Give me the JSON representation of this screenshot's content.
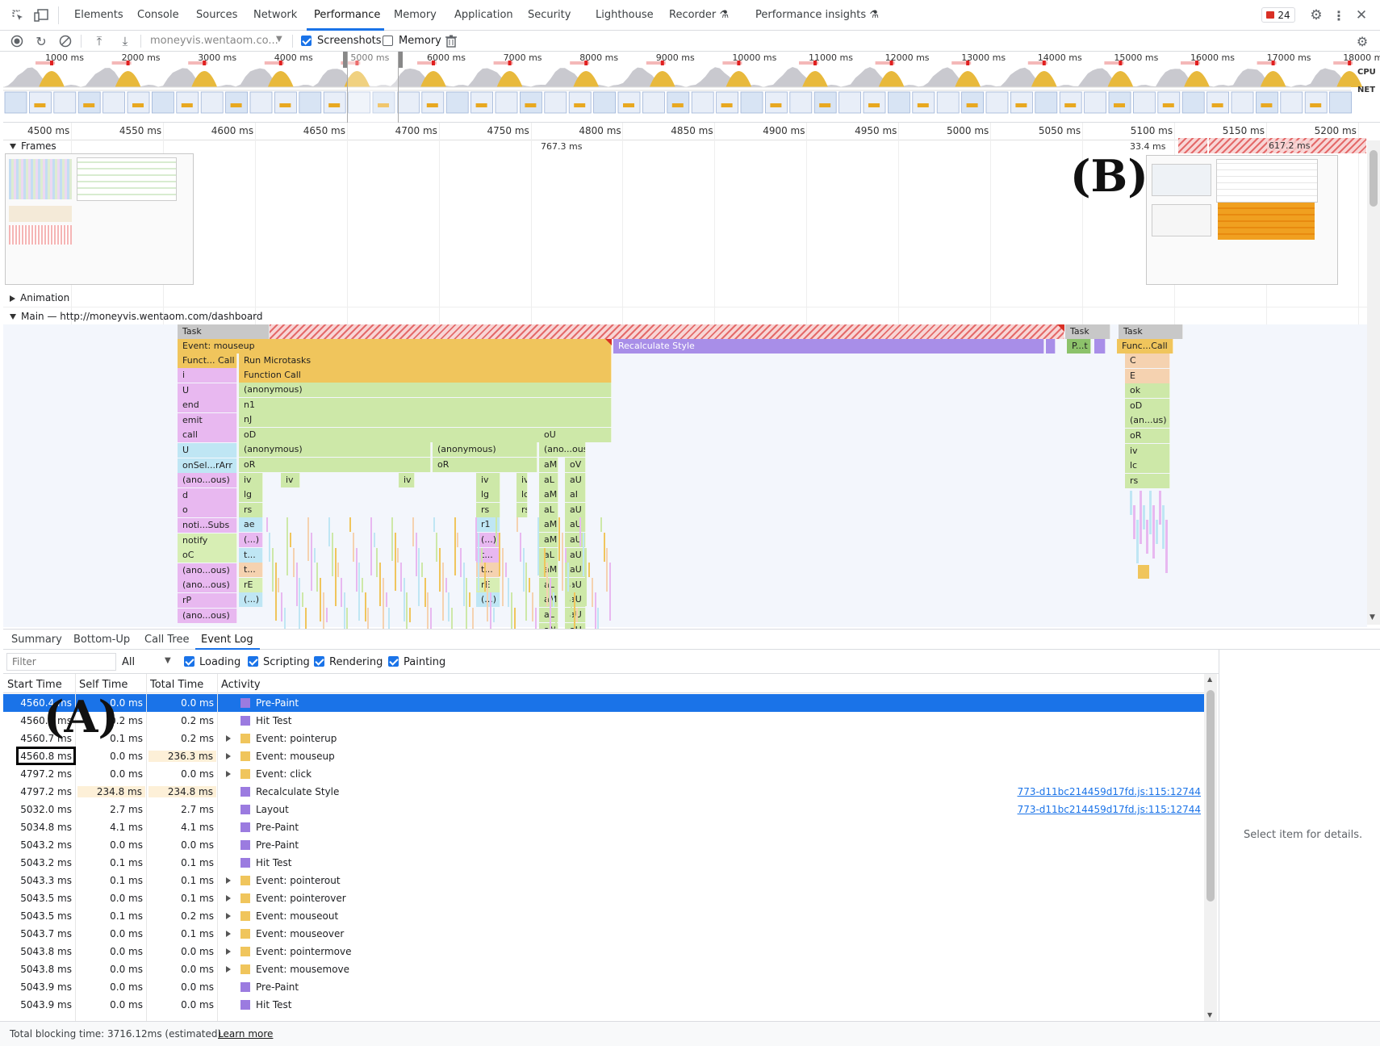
{
  "tabs": [
    "Elements",
    "Console",
    "Sources",
    "Network",
    "Performance",
    "Memory",
    "Application",
    "Security",
    "Lighthouse",
    "Recorder",
    "Performance insights"
  ],
  "active_tab": "Performance",
  "issues_count": "24",
  "toolbar": {
    "url": "moneyvis.wentaom.co...",
    "screenshots_label": "Screenshots",
    "memory_label": "Memory"
  },
  "overview": {
    "labels": [
      "1000 ms",
      "2000 ms",
      "3000 ms",
      "4000 ms",
      "5000 ms",
      "6000 ms",
      "7000 ms",
      "8000 ms",
      "9000 ms",
      "10000 ms",
      "11000 ms",
      "12000 ms",
      "13000 ms",
      "14000 ms",
      "15000 ms",
      "16000 ms",
      "17000 ms",
      "18000 ms"
    ],
    "cpu_label": "CPU",
    "net_label": "NET"
  },
  "ruler": {
    "labels": [
      "4500 ms",
      "4550 ms",
      "4600 ms",
      "4650 ms",
      "4700 ms",
      "4750 ms",
      "4800 ms",
      "4850 ms",
      "4900 ms",
      "4950 ms",
      "5000 ms",
      "5050 ms",
      "5100 ms",
      "5150 ms",
      "5200 ms"
    ]
  },
  "tracks": {
    "frames_label": "Frames",
    "frame_duration_1": "767.3 ms",
    "frame_duration_2": "33.4 ms",
    "frame_duration_3": "617.2 ms",
    "animation_label": "Animation",
    "main_label": "Main — http://moneyvis.wentaom.com/dashboard"
  },
  "flame": {
    "task": "Task",
    "task2": "Task",
    "task3": "Task",
    "event_mouseup": "Event: mouseup",
    "recalc": "Recalculate Style",
    "pt": "P...t",
    "funccall_r": "Func...Call",
    "funct_call": "Funct... Call",
    "run_micro": "Run Microtasks",
    "function_call": "Function Call",
    "left_col": [
      "i",
      "U",
      "end",
      "emit",
      "call",
      "U",
      "onSel...rArr",
      "(ano...ous)",
      "d",
      "o",
      "noti...Subs",
      "notify",
      "oC",
      "(ano...ous)",
      "(ano...ous)",
      "rP",
      "(ano...ous)"
    ],
    "col2": [
      "(anonymous)",
      "n1",
      "nJ",
      "oD",
      "(anonymous)",
      "oR",
      "iv",
      "lg",
      "rs",
      "ae",
      "(...)",
      "t...",
      "t...",
      "rE",
      "(...)"
    ],
    "col2_small": [
      "iv"
    ],
    "col3": [
      "(anonymous)",
      "oR"
    ],
    "col3b": [
      "iv",
      "lg",
      "rs",
      "r1",
      "(...)",
      "t...",
      "t...",
      "rE",
      "(...)"
    ],
    "col_iv": [
      "iv",
      "lc",
      "rs"
    ],
    "col_ou": [
      "oU",
      "(ano...ous)",
      "aM",
      "aL",
      "aM",
      "aL",
      "aM",
      "aM",
      "aL",
      "aM",
      "aL",
      "aM",
      "aL",
      "aM"
    ],
    "col_ov": [
      "oV",
      "aU",
      "aI",
      "aU",
      "aU",
      "aU",
      "aU",
      "aU",
      "aU",
      "aU",
      "aU",
      "aU"
    ],
    "right_col": [
      "C",
      "E",
      "ok",
      "oD",
      "(an...us)",
      "oR",
      "iv",
      "lc",
      "rs"
    ]
  },
  "bottom_tabs": [
    "Summary",
    "Bottom-Up",
    "Call Tree",
    "Event Log"
  ],
  "active_bottom_tab": "Event Log",
  "filter": {
    "placeholder": "Filter",
    "select_value": "All",
    "checkboxes": [
      "Loading",
      "Scripting",
      "Rendering",
      "Painting"
    ]
  },
  "table": {
    "headers": [
      "Start Time",
      "Self Time",
      "Total Time",
      "Activity"
    ],
    "rows": [
      {
        "start": "4560.4 ms",
        "self": "0.0 ms",
        "total": "0.0 ms",
        "activity": "Pre-Paint",
        "color": "#9b7be0",
        "expand": false,
        "link": ""
      },
      {
        "start": "4560.4 ms",
        "self": "0.2 ms",
        "total": "0.2 ms",
        "activity": "Hit Test",
        "color": "#9b7be0",
        "expand": false,
        "link": ""
      },
      {
        "start": "4560.7 ms",
        "self": "0.1 ms",
        "total": "0.2 ms",
        "activity": "Event: pointerup",
        "color": "#f0c55c",
        "expand": true,
        "link": ""
      },
      {
        "start": "4560.8 ms",
        "self": "0.0 ms",
        "total": "236.3 ms",
        "activity": "Event: mouseup",
        "color": "#f0c55c",
        "expand": true,
        "link": ""
      },
      {
        "start": "4797.2 ms",
        "self": "0.0 ms",
        "total": "0.0 ms",
        "activity": "Event: click",
        "color": "#f0c55c",
        "expand": true,
        "link": ""
      },
      {
        "start": "4797.2 ms",
        "self": "234.8 ms",
        "total": "234.8 ms",
        "activity": "Recalculate Style",
        "color": "#9b7be0",
        "expand": false,
        "link": "773-d11bc214459d17fd.js:115:12744"
      },
      {
        "start": "5032.0 ms",
        "self": "2.7 ms",
        "total": "2.7 ms",
        "activity": "Layout",
        "color": "#9b7be0",
        "expand": false,
        "link": "773-d11bc214459d17fd.js:115:12744"
      },
      {
        "start": "5034.8 ms",
        "self": "4.1 ms",
        "total": "4.1 ms",
        "activity": "Pre-Paint",
        "color": "#9b7be0",
        "expand": false,
        "link": ""
      },
      {
        "start": "5043.2 ms",
        "self": "0.0 ms",
        "total": "0.0 ms",
        "activity": "Pre-Paint",
        "color": "#9b7be0",
        "expand": false,
        "link": ""
      },
      {
        "start": "5043.2 ms",
        "self": "0.1 ms",
        "total": "0.1 ms",
        "activity": "Hit Test",
        "color": "#9b7be0",
        "expand": false,
        "link": ""
      },
      {
        "start": "5043.3 ms",
        "self": "0.1 ms",
        "total": "0.1 ms",
        "activity": "Event: pointerout",
        "color": "#f0c55c",
        "expand": true,
        "link": ""
      },
      {
        "start": "5043.5 ms",
        "self": "0.0 ms",
        "total": "0.1 ms",
        "activity": "Event: pointerover",
        "color": "#f0c55c",
        "expand": true,
        "link": ""
      },
      {
        "start": "5043.5 ms",
        "self": "0.1 ms",
        "total": "0.2 ms",
        "activity": "Event: mouseout",
        "color": "#f0c55c",
        "expand": true,
        "link": ""
      },
      {
        "start": "5043.7 ms",
        "self": "0.0 ms",
        "total": "0.1 ms",
        "activity": "Event: mouseover",
        "color": "#f0c55c",
        "expand": true,
        "link": ""
      },
      {
        "start": "5043.8 ms",
        "self": "0.0 ms",
        "total": "0.0 ms",
        "activity": "Event: pointermove",
        "color": "#f0c55c",
        "expand": true,
        "link": ""
      },
      {
        "start": "5043.8 ms",
        "self": "0.0 ms",
        "total": "0.0 ms",
        "activity": "Event: mousemove",
        "color": "#f0c55c",
        "expand": true,
        "link": ""
      },
      {
        "start": "5043.9 ms",
        "self": "0.0 ms",
        "total": "0.0 ms",
        "activity": "Pre-Paint",
        "color": "#9b7be0",
        "expand": false,
        "link": ""
      },
      {
        "start": "5043.9 ms",
        "self": "0.0 ms",
        "total": "0.0 ms",
        "activity": "Hit Test",
        "color": "#9b7be0",
        "expand": false,
        "link": ""
      }
    ]
  },
  "details_text": "Select item for details.",
  "status": {
    "text": "Total blocking time: 3716.12ms (estimated)",
    "learn_more": "Learn more"
  },
  "annotations": {
    "a": "(A)",
    "b": "(B)"
  }
}
